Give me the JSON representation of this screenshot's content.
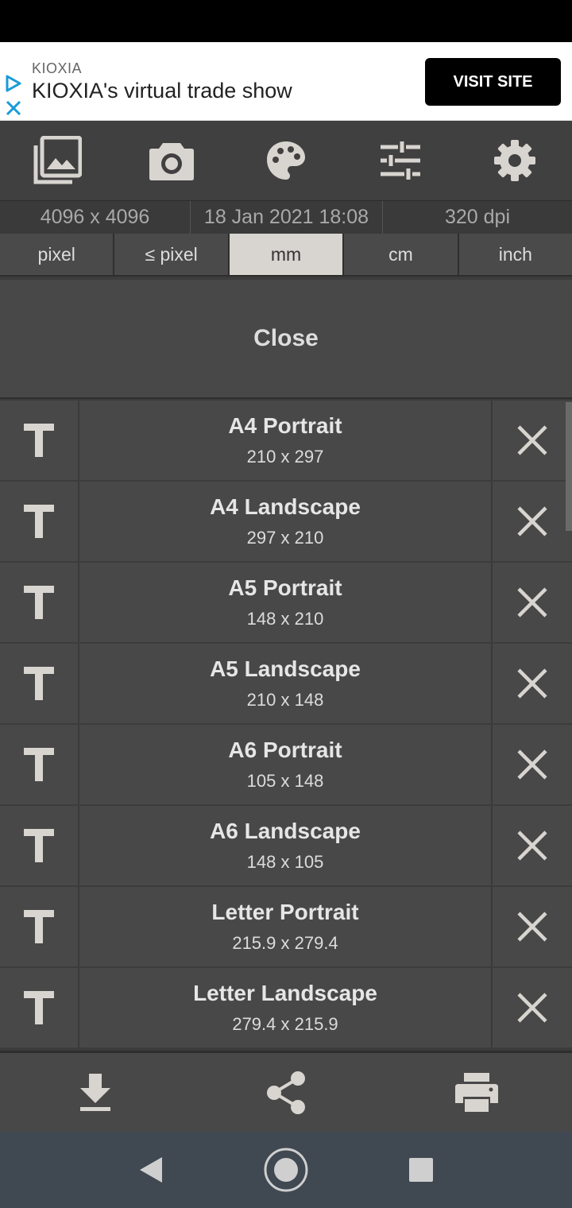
{
  "ad": {
    "brand": "KIOXIA",
    "headline": "KIOXIA's virtual trade show",
    "cta": "VISIT SITE"
  },
  "toolbar": {
    "icons": [
      "gallery-icon",
      "camera-icon",
      "palette-icon",
      "sliders-icon",
      "settings-icon"
    ]
  },
  "info": {
    "resolution": "4096 x 4096",
    "date": "18 Jan 2021 18:08",
    "dpi": "320 dpi"
  },
  "units": {
    "options": [
      "pixel",
      "≤ pixel",
      "mm",
      "cm",
      "inch"
    ],
    "selected": "mm"
  },
  "close_label": "Close",
  "sizes": [
    {
      "name": "A4 Portrait",
      "dims": "210 x 297"
    },
    {
      "name": "A4 Landscape",
      "dims": "297 x 210"
    },
    {
      "name": "A5 Portrait",
      "dims": "148 x 210"
    },
    {
      "name": "A5 Landscape",
      "dims": "210 x 148"
    },
    {
      "name": "A6 Portrait",
      "dims": "105 x 148"
    },
    {
      "name": "A6 Landscape",
      "dims": "148 x 105"
    },
    {
      "name": "Letter Portrait",
      "dims": "215.9 x 279.4"
    },
    {
      "name": "Letter Landscape",
      "dims": "279.4 x 215.9"
    }
  ],
  "colors": {
    "background": "#3c3c3c",
    "row": "#484848",
    "selected_unit": "#d8d5d0",
    "icon": "#d8d5d0"
  }
}
